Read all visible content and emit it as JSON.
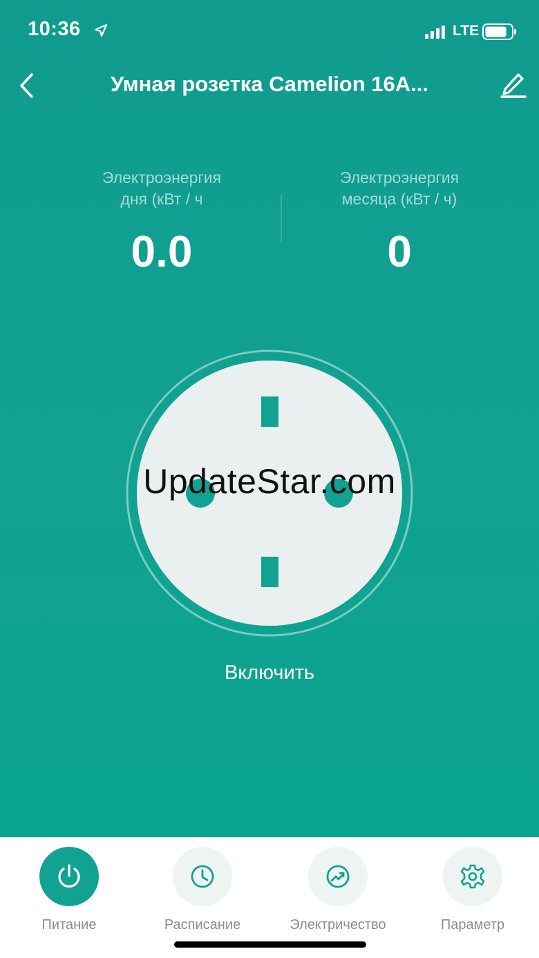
{
  "status_bar": {
    "time": "10:36",
    "network": "LTE"
  },
  "header": {
    "title": "Умная розетка Camelion 16A..."
  },
  "energy": {
    "day": {
      "label_line1": "Электроэнергия",
      "label_line2": "дня (кВт / ч",
      "value": "0.0"
    },
    "month": {
      "label_line1": "Электроэнергия",
      "label_line2": "месяца (кВт / ч)",
      "value": "0"
    }
  },
  "power": {
    "label": "Включить"
  },
  "watermark": "UpdateStar.com",
  "nav": {
    "items": [
      {
        "label": "Питание",
        "icon": "power-icon"
      },
      {
        "label": "Расписание",
        "icon": "clock-icon"
      },
      {
        "label": "Электричество",
        "icon": "chart-icon"
      },
      {
        "label": "Параметр",
        "icon": "gear-icon"
      }
    ]
  },
  "colors": {
    "accent": "#12a291",
    "socket_face": "#eaf0ef",
    "nav_inactive_bg": "#eef4f2"
  }
}
